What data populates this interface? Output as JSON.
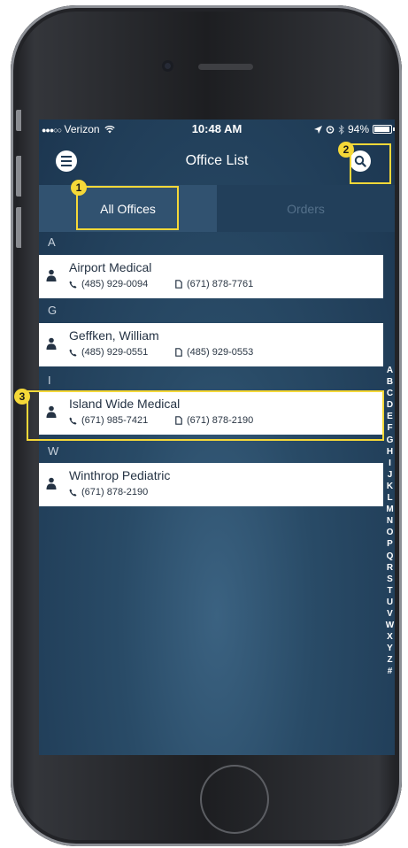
{
  "status_bar": {
    "signal_dots": "●●●○○",
    "carrier": "Verizon",
    "wifi_icon": "wifi-icon",
    "time": "10:48 AM",
    "location_icon": "location-arrow-icon",
    "alarm_icon": "alarm-icon",
    "bluetooth_icon": "bluetooth-icon",
    "battery": "94%",
    "battery_level": 0.94
  },
  "nav": {
    "title": "Office List",
    "menu_icon": "menu-icon",
    "search_icon": "search-icon"
  },
  "tabs": [
    {
      "label": "All Offices",
      "active": true
    },
    {
      "label": "Orders",
      "active": false
    }
  ],
  "sections": [
    {
      "letter": "A",
      "offices": [
        {
          "name": "Airport Medical",
          "phone": "(485) 929-0094",
          "fax": "(671) 878-7761"
        }
      ]
    },
    {
      "letter": "G",
      "offices": [
        {
          "name": "Geffken, William",
          "phone": "(485) 929-0551",
          "fax": "(485) 929-0553"
        }
      ]
    },
    {
      "letter": "I",
      "offices": [
        {
          "name": "Island Wide Medical",
          "phone": "(671) 985-7421",
          "fax": "(671) 878-2190"
        }
      ]
    },
    {
      "letter": "W",
      "offices": [
        {
          "name": "Winthrop Pediatric",
          "phone": "(671) 878-2190",
          "fax": ""
        }
      ]
    }
  ],
  "alphabet_index": [
    "A",
    "B",
    "C",
    "D",
    "E",
    "F",
    "G",
    "H",
    "I",
    "J",
    "K",
    "L",
    "M",
    "N",
    "O",
    "P",
    "Q",
    "R",
    "S",
    "T",
    "U",
    "V",
    "W",
    "X",
    "Y",
    "Z",
    "#"
  ],
  "callouts": [
    {
      "number": "1",
      "target": "All Offices tab"
    },
    {
      "number": "2",
      "target": "search button"
    },
    {
      "number": "3",
      "target": "Island Wide Medical row"
    }
  ],
  "colors": {
    "highlight": "#f5d838",
    "background": "#294b67",
    "active_tab": "#315270",
    "inactive_tab_text": "#54708a"
  }
}
